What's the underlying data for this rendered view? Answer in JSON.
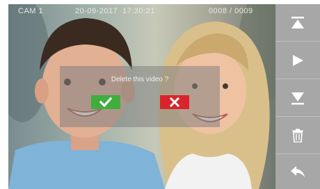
{
  "status_bar": {
    "camera": "CAM 1",
    "date": "20-09-2017",
    "time": "17:30:21",
    "counter": "0008 / 0009"
  },
  "dialog": {
    "message": "Delete this video ?",
    "confirm_icon": "checkmark-icon",
    "cancel_icon": "close-icon",
    "confirm_color": "#3fae3f",
    "cancel_color": "#d8252b"
  },
  "sidebar": {
    "background": "#a7a7a7",
    "buttons": [
      {
        "icon": "skip-up-icon"
      },
      {
        "icon": "play-icon"
      },
      {
        "icon": "skip-down-icon"
      },
      {
        "icon": "trash-icon"
      },
      {
        "icon": "back-arrow-icon"
      }
    ]
  }
}
